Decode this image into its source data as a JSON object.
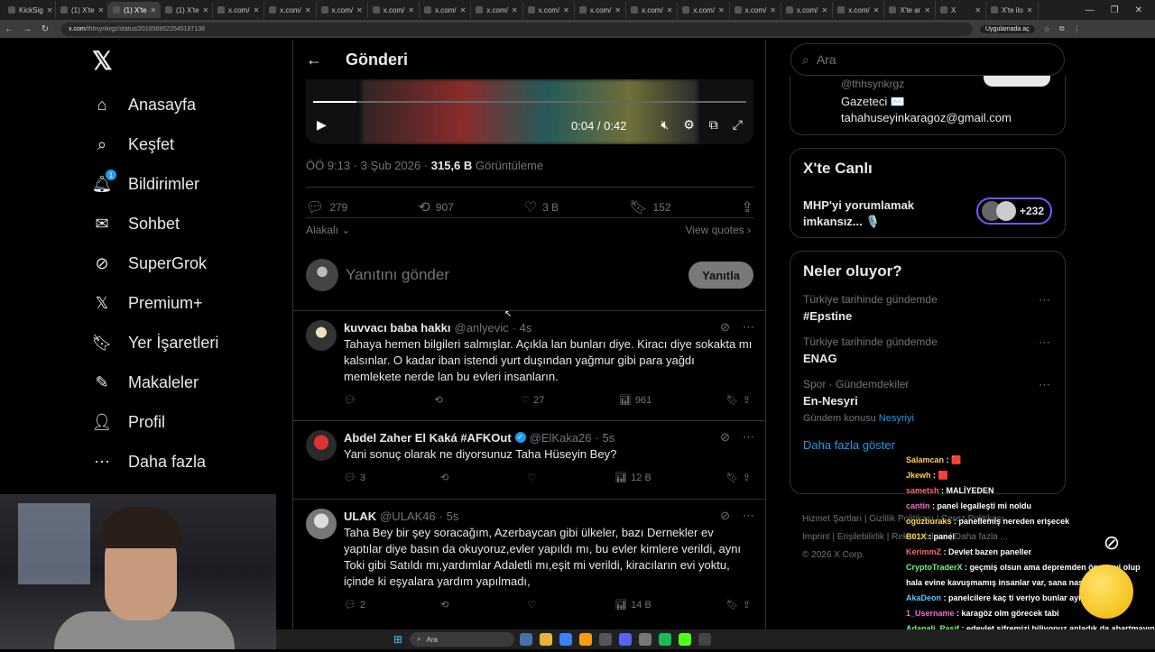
{
  "browser": {
    "tabs": [
      "KickSig",
      "(1) X'te",
      "(1) X'te",
      "(1) X'te",
      "x.com/",
      "x.com/",
      "x.com/",
      "x.com/",
      "x.com/",
      "x.com/",
      "x.com/",
      "x.com/",
      "x.com/",
      "x.com/",
      "x.com/",
      "x.com/",
      "x.com/",
      "X'te ar",
      "X",
      "X'te ilo"
    ],
    "url_domain": "x.com",
    "url_path": "/thhsynkrgz/status/2018568522545197138",
    "app_button": "Uygulamada aç"
  },
  "nav": {
    "items": [
      {
        "label": "Anasayfa",
        "icon": "home-icon"
      },
      {
        "label": "Keşfet",
        "icon": "search-icon"
      },
      {
        "label": "Bildirimler",
        "icon": "bell-icon",
        "badge": "1"
      },
      {
        "label": "Sohbet",
        "icon": "mail-icon"
      },
      {
        "label": "SuperGrok",
        "icon": "grok-icon"
      },
      {
        "label": "Premium+",
        "icon": "x-logo-icon"
      },
      {
        "label": "Yer İşaretleri",
        "icon": "bookmark-icon"
      },
      {
        "label": "Makaleler",
        "icon": "article-icon"
      },
      {
        "label": "Profil",
        "icon": "profile-icon"
      },
      {
        "label": "Daha fazla",
        "icon": "more-icon"
      }
    ]
  },
  "post": {
    "header_title": "Gönderi",
    "video_time": "0:04 / 0:42",
    "video_progress": 0.1,
    "meta_time": "ÖÖ 9:13 · 3 Şub 2026 · ",
    "views": "315,6 B",
    "views_label": " Görüntüleme",
    "stats": {
      "replies": "279",
      "reposts": "907",
      "likes": "3 B",
      "bookmarks": "152"
    },
    "sort_label": "Alakalı",
    "view_quotes": "View quotes",
    "reply_placeholder": "Yanıtını gönder",
    "reply_button": "Yanıtla"
  },
  "replies": [
    {
      "name": "kuvvacı baba hakkı",
      "handle": "@anlyevic",
      "time": "· 4s",
      "verified": false,
      "text": "Tahaya hemen bilgileri salmışlar. Açıkla lan bunları diye. Kiracı diye sokakta mı kalsınlar. O kadar iban istendi yurt duşından yağmur gibi para yağdı memlekete nerde lan bu evleri insanların.",
      "replies": "",
      "reposts": "",
      "likes": "27",
      "views": "961"
    },
    {
      "name": "Abdel Zaher El Kaká #AFKOut",
      "handle": "@ElKaka26",
      "time": "· 5s",
      "verified": true,
      "text": "Yani sonuç olarak ne diyorsunuz Taha Hüseyin Bey?",
      "replies": "3",
      "reposts": "",
      "likes": "",
      "views": "12 B"
    },
    {
      "name": "ULAK",
      "handle": "@ULAK46",
      "time": "· 5s",
      "verified": false,
      "text": "Taha Bey bir şey soracağım, Azerbaycan gibi ülkeler, bazı Dernekler ev yaptılar diye basın da okuyoruz,evler yapıldı mı, bu evler kimlere verildi, aynı Toki gibi Satıldı mı,yardımlar Adaletli mı,eşit mi verildi, kiracıların evi yoktu, içinde ki eşyalara yardım yapılmadı,",
      "replies": "2",
      "reposts": "",
      "likes": "",
      "views": "14 B"
    }
  ],
  "right": {
    "search_placeholder": "Ara",
    "profile": {
      "handle": "@thhsynkrgz",
      "bio1": "Gazeteci ✉️",
      "bio2": "tahahuseyinkaragoz@gmail.com"
    },
    "live": {
      "title": "X'te Canlı",
      "text": "MHP'yi yorumlamak imkansız... 🎙️",
      "count": "+232"
    },
    "trends": {
      "title": "Neler oluyor?",
      "items": [
        {
          "context": "Türkiye tarihinde gündemde",
          "topic": "#Epstine",
          "sub": "",
          "sub_link": ""
        },
        {
          "context": "Türkiye tarihinde gündemde",
          "topic": "ENAG",
          "sub": "",
          "sub_link": ""
        },
        {
          "context": "Spor · Gündemdekiler",
          "topic": "En-Nesyri",
          "sub": "Gündem konusu ",
          "sub_link": "Nesyriyi"
        }
      ],
      "show_more": "Daha fazla göster"
    },
    "footer": {
      "line1": "Hizmet Şartları  |  Gizlilik Politikası  |  Çerez Politikası",
      "line2": "Imprint  |  Erişilebilirlik  |  Reklam bilgisi  |  Daha fazla ...",
      "line3": "© 2026 X Corp."
    }
  },
  "chat": [
    {
      "user": "Salamcan",
      "msg": " : 🟥"
    },
    {
      "user": "Jkewh",
      "msg": " : 🟥"
    },
    {
      "user": "sametsh",
      "msg": " : MALİYEDEN"
    },
    {
      "user": "cantin",
      "msg": " : panel legalleşti mi noldu"
    },
    {
      "user": "oguzburaks",
      "msg": " : panellemiş nereden erişecek"
    },
    {
      "user": "B01X",
      "msg": " : panel"
    },
    {
      "user": "KerimmZ",
      "msg": " : Devlet bazen paneller"
    },
    {
      "user": "CryptoTraderX",
      "msg": " : geçmiş olsun ama depremden önce evi olup hala evine kavuşmamış insanlar var, sana nasıl verdiler"
    },
    {
      "user": "AkaDeon",
      "msg": " : panelcilere kaç ti veriyo bunlar aylık"
    },
    {
      "user": "1_Username",
      "msg": " : karagöz olm görecek tabi"
    },
    {
      "user": "Adanali_Pasif",
      "msg": " : edevlet şifremizi biliyonuz anladık da abartmayın lan slkfdskj"
    }
  ],
  "taskbar": {
    "search": "Ara"
  }
}
